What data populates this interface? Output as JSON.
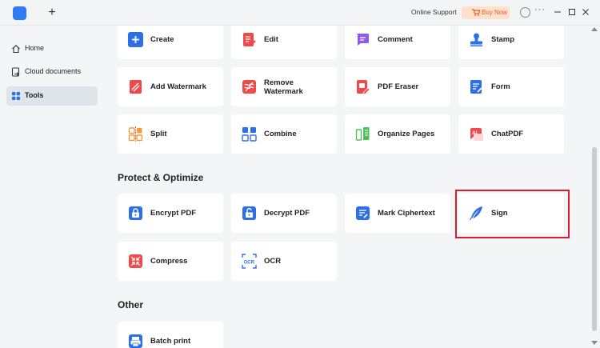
{
  "titlebar": {
    "new_tab": "+",
    "online_support": "Online Support",
    "buy_now": "Buy Now",
    "more": "···"
  },
  "sidebar": {
    "items": [
      {
        "label": "Home",
        "icon": "home-icon"
      },
      {
        "label": "Cloud documents",
        "icon": "cloud-document-icon"
      },
      {
        "label": "Tools",
        "icon": "grid-icon",
        "active": true
      }
    ]
  },
  "tools": [
    {
      "label": "Create",
      "icon": "plus-icon",
      "color": "#2f6fe4"
    },
    {
      "label": "Edit",
      "icon": "edit-icon",
      "color": "#ee4a4a"
    },
    {
      "label": "Comment",
      "icon": "comment-icon",
      "color": "#8f5be8"
    },
    {
      "label": "Stamp",
      "icon": "stamp-icon",
      "color": "#2f6fe4"
    },
    {
      "label": "Add Watermark",
      "icon": "watermark-icon",
      "color": "#ee4a4a"
    },
    {
      "label": "Remove\nWatermark",
      "icon": "remove-watermark-icon",
      "color": "#ee4a4a"
    },
    {
      "label": "PDF Eraser",
      "icon": "eraser-icon",
      "color": "#ee4a4a"
    },
    {
      "label": "Form",
      "icon": "form-icon",
      "color": "#2f6fe4"
    },
    {
      "label": "Split",
      "icon": "split-icon",
      "color": "#f39a3d"
    },
    {
      "label": "Combine",
      "icon": "combine-icon",
      "color": "#2f6fe4"
    },
    {
      "label": "Organize Pages",
      "icon": "organize-pages-icon",
      "color": "#4fbf5a"
    },
    {
      "label": "ChatPDF",
      "icon": "chatpdf-icon",
      "color": "#ee4a4a"
    }
  ],
  "protect": {
    "title": "Protect & Optimize",
    "tools": [
      {
        "label": "Encrypt PDF",
        "icon": "lock-icon",
        "color": "#2f6fe4"
      },
      {
        "label": "Decrypt PDF",
        "icon": "unlock-icon",
        "color": "#2f6fe4"
      },
      {
        "label": "Mark Ciphertext",
        "icon": "ciphertext-icon",
        "color": "#2f6fe4"
      },
      {
        "label": "Sign",
        "icon": "feather-pen-icon",
        "color": "#2f6fe4"
      },
      {
        "label": "Compress",
        "icon": "compress-icon",
        "color": "#ee4a4a"
      },
      {
        "label": "OCR",
        "icon": "ocr-icon",
        "color": "#2f6fe4"
      }
    ]
  },
  "other": {
    "title": "Other",
    "tools": [
      {
        "label": "Batch print",
        "icon": "print-icon",
        "color": "#2f6fe4"
      }
    ]
  }
}
